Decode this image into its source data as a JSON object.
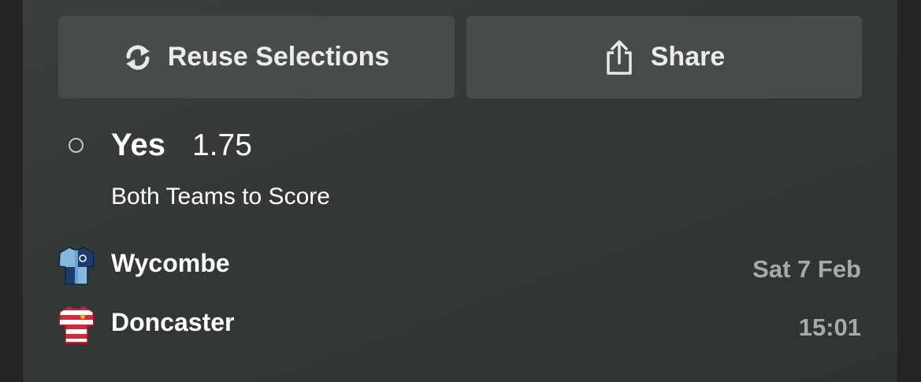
{
  "actions": {
    "reuse_label": "Reuse Selections",
    "reuse_icon": "refresh-icon",
    "share_label": "Share",
    "share_icon": "share-icon"
  },
  "selection": {
    "name": "Yes",
    "odds": "1.75",
    "market": "Both Teams to Score"
  },
  "match": {
    "home_team": "Wycombe",
    "home_kit_icon": "jersey-icon",
    "away_team": "Doncaster",
    "away_kit_icon": "jersey-icon",
    "date": "Sat 7 Feb",
    "time": "15:01"
  },
  "colors": {
    "background": "#242626",
    "card": "#363b39",
    "button": "#454c49",
    "text": "#ffffff",
    "muted_text": "#a6aaa8"
  }
}
